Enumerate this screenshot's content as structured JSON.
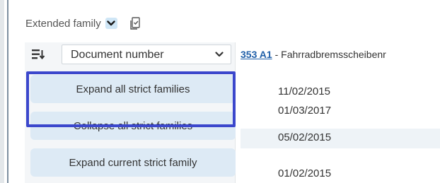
{
  "toolbar": {
    "label": "Extended family",
    "dropdown_icon": "chevron-down-icon",
    "document_icon": "document-check-icon"
  },
  "menu": {
    "sort_icon": "sort-list-icon",
    "sort_select": {
      "value": "Document number",
      "chevron_icon": "chevron-down-icon"
    },
    "items": [
      {
        "label": "Expand all strict families"
      },
      {
        "label": "Collapse all strict families"
      },
      {
        "label": "Expand current strict family"
      }
    ]
  },
  "list": {
    "header": {
      "link_text": "353 A1",
      "text": "- Fahrradbremsscheibenr"
    },
    "dates": [
      "11/02/2015",
      "01/03/2017",
      "05/02/2015",
      "01/02/2015"
    ]
  },
  "colors": {
    "accent_highlight": "#3b47cc",
    "menu_item_bg": "#ddeaf5",
    "link": "#1f5fa8"
  }
}
